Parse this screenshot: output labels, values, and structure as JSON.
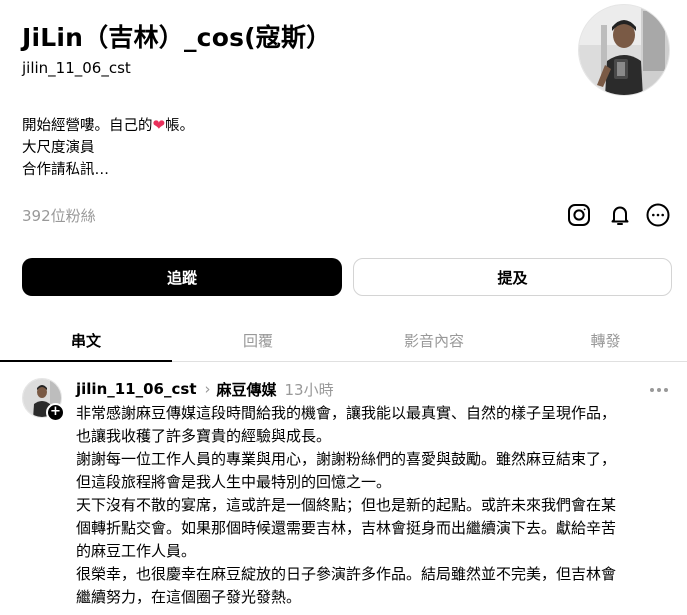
{
  "profile": {
    "name": "JiLin（吉林）_cos(寇斯）",
    "handle": "jilin_11_06_cst",
    "bio_line1_before": "開始經營嘍。自己的",
    "bio_heart": "❤",
    "bio_line1_after": "帳。",
    "bio_line2": "大尺度演員",
    "bio_line3": "合作請私訊…",
    "followers": "392位粉絲"
  },
  "icons": {
    "instagram": "instagram-icon",
    "bell": "bell-icon",
    "more": "more-circle-icon"
  },
  "buttons": {
    "follow": "追蹤",
    "mention": "提及"
  },
  "tabs": [
    {
      "label": "串文",
      "active": true
    },
    {
      "label": "回覆",
      "active": false
    },
    {
      "label": "影音內容",
      "active": false
    },
    {
      "label": "轉發",
      "active": false
    }
  ],
  "post": {
    "user": "jilin_11_06_cst",
    "separator": "›",
    "community": "麻豆傳媒",
    "time": "13小時",
    "plus": "+",
    "lines": [
      "非常感謝麻豆傳媒這段時間給我的機會，讓我能以最真實、自然的樣子呈現作品，",
      "也讓我收穫了許多寶貴的經驗與成長。",
      "謝謝每一位工作人員的專業與用心，謝謝粉絲們的喜愛與鼓勵。雖然麻豆結束了，",
      "但這段旅程將會是我人生中最特別的回憶之一。",
      "天下沒有不散的宴席，這或許是一個終點；但也是新的起點。或許未來我們會在某",
      "個轉折點交會。如果那個時候還需要吉林，吉林會挺身而出繼續演下去。獻給辛苦",
      "的麻豆工作人員。",
      "很榮幸，也很慶幸在麻豆綻放的日子參演許多作品。結局雖然並不完美，但吉林會",
      "繼續努力，在這個圈子發光發熱。"
    ]
  }
}
